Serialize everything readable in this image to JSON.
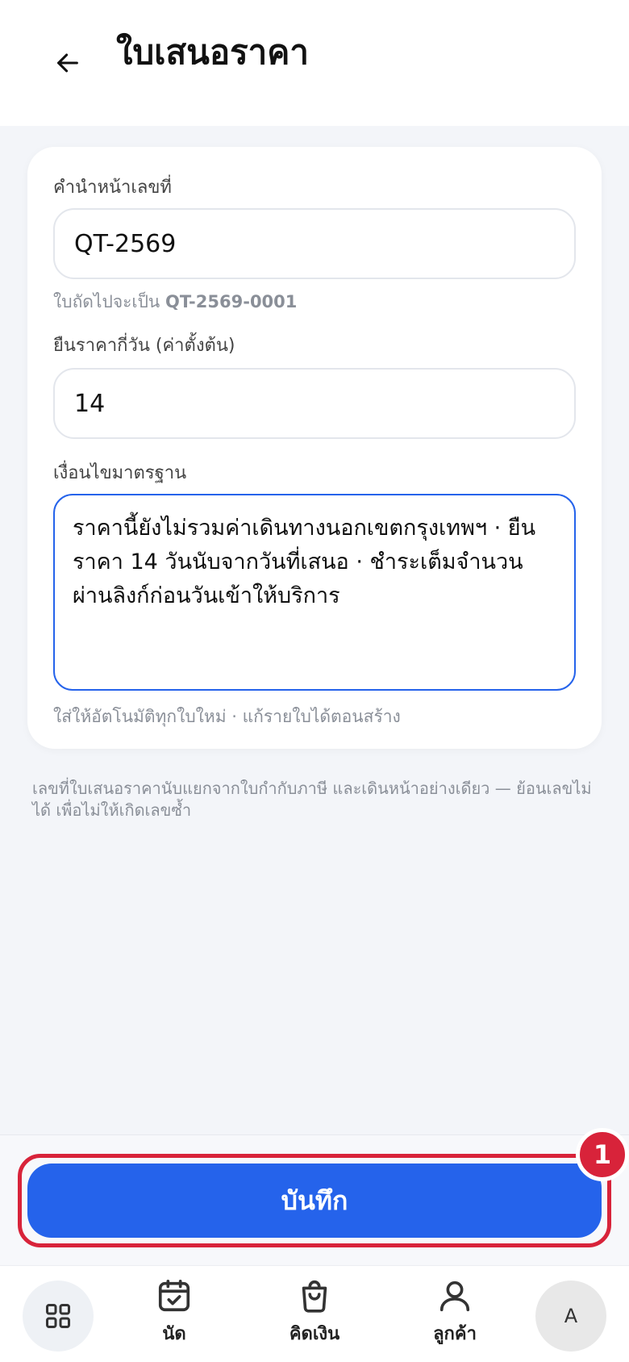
{
  "header": {
    "title": "ใบเสนอราคา",
    "back_icon": "arrow-left-icon"
  },
  "form": {
    "prefix_label": "คำนำหน้าเลขที่",
    "prefix_value": "QT-2569",
    "prefix_hint_text": "ใบถัดไปจะเป็น",
    "prefix_hint_next": "QT-2569-0001",
    "validity_label": "ยืนราคากี่วัน (ค่าตั้งต้น)",
    "validity_value": "14",
    "terms_label": "เงื่อนไขมาตรฐาน",
    "terms_value": "ราคานี้ยังไม่รวมค่าเดินทางนอกเขตกรุงเทพฯ · ยืนราคา 14 วันนับจากวันที่เสนอ · ชำระเต็มจำนวนผ่านลิงก์ก่อนวันเข้าให้บริการ",
    "terms_hint": "ใส่ให้อัตโนมัติทุกใบใหม่ · แก้รายใบได้ตอนสร้าง"
  },
  "footnote": "เลขที่ใบเสนอราคานับแยกจากใบกำกับภาษี และเดินหน้าอย่างเดียว — ย้อนเลขไม่ได้ เพื่อไม่ให้เกิดเลขซ้ำ",
  "save_button": "บันทึก",
  "badge": "1",
  "nav": {
    "home_icon": "grid-icon",
    "appointments": "นัด",
    "checkout": "คิดเงิน",
    "customers": "ลูกค้า",
    "avatar": "A"
  },
  "colors": {
    "accent": "#2563eb",
    "highlight": "#d8233a"
  }
}
